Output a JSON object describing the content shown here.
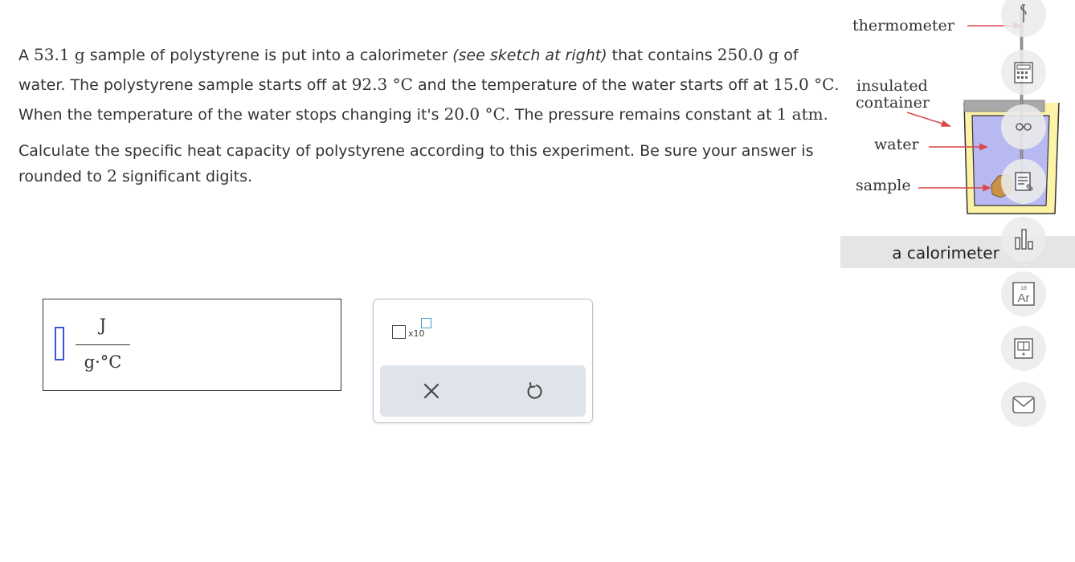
{
  "problem": {
    "p1_a": "A ",
    "mass_sample": "53.1 g",
    "p1_b": " sample of polystyrene is put into a calorimeter ",
    "see_sketch": "(see sketch at right)",
    "p1_c": " that contains ",
    "mass_water": "250.0 g",
    "p1_d": " of water. The polystyrene sample starts off at ",
    "temp_sample": "92.3 °C",
    "p1_e": " and the temperature of the water starts off at ",
    "temp_water": "15.0 °C",
    "p1_f": ". When the temperature of the water stops changing it's ",
    "temp_final": "20.0 °C",
    "p1_g": ". The pressure remains constant at ",
    "pressure": "1 atm",
    "p1_h": ".",
    "q_a": "Calculate the specific heat capacity of polystyrene according to this experiment. Be sure your answer is rounded to ",
    "sig_figs": "2",
    "q_b": " significant digits."
  },
  "answer": {
    "value": "",
    "unit_numerator": "J",
    "unit_denominator": "g·°C"
  },
  "toolbox": {
    "sci_label": "x10",
    "clear_icon": "x-icon",
    "reset_icon": "undo-icon"
  },
  "sketch": {
    "label_thermometer": "thermometer",
    "label_insulated": "insulated",
    "label_container": "container",
    "label_water": "water",
    "label_sample": "sample",
    "caption": "a calorimeter"
  },
  "rail": {
    "icons": [
      "thermometer-icon",
      "calculator-icon",
      "glasses-icon",
      "notes-icon",
      "chart-icon",
      "periodic-table-icon",
      "book-icon",
      "mail-icon"
    ],
    "periodic_number": "18",
    "periodic_symbol": "Ar"
  },
  "colors": {
    "input_border": "#3a55d6",
    "arrow": "#d9474a",
    "water": "#b9b9f2",
    "container": "#fdf3a6",
    "sample": "#c8924a"
  }
}
